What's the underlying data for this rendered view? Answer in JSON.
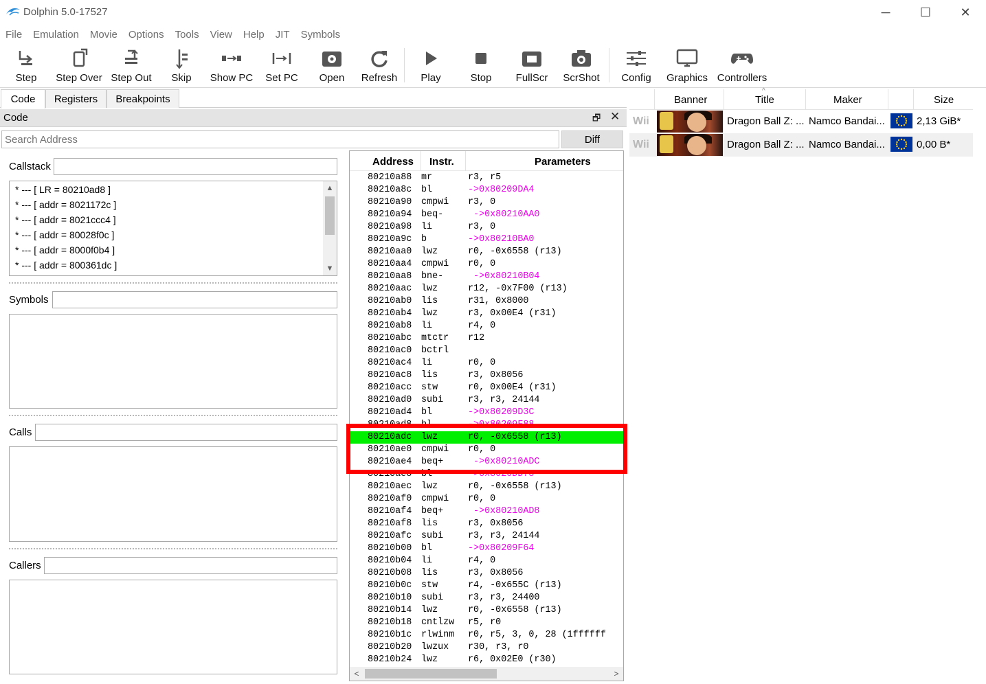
{
  "window": {
    "title": "Dolphin 5.0-17527",
    "minimize": "─",
    "maximize": "☐",
    "close": "✕"
  },
  "menu": [
    "File",
    "Emulation",
    "Movie",
    "Options",
    "Tools",
    "View",
    "Help",
    "JIT",
    "Symbols"
  ],
  "toolbar": {
    "step": "Step",
    "step_over": "Step Over",
    "step_out": "Step Out",
    "skip": "Skip",
    "show_pc": "Show PC",
    "set_pc": "Set PC",
    "open": "Open",
    "refresh": "Refresh",
    "play": "Play",
    "stop": "Stop",
    "fullscr": "FullScr",
    "scrshot": "ScrShot",
    "config": "Config",
    "graphics": "Graphics",
    "controllers": "Controllers"
  },
  "tabs": [
    "Code",
    "Registers",
    "Breakpoints"
  ],
  "code_panel": {
    "title": "Code",
    "float_icon": "🗗",
    "close_icon": "✕",
    "search_placeholder": "Search Address",
    "diff_label": "Diff",
    "callstack_label": "Callstack",
    "symbols_label": "Symbols",
    "calls_label": "Calls",
    "callers_label": "Callers",
    "callstack": [
      "*  ---  [ LR = 80210ad8 ]",
      "*  ---  [ addr = 8021172c ]",
      "*  ---  [ addr = 8021ccc4 ]",
      "*  ---  [ addr = 80028f0c ]",
      "*  ---  [ addr = 8000f0b4 ]",
      "*  ---  [ addr = 800361dc ]"
    ]
  },
  "code_view": {
    "columns": [
      "Address",
      "Instr.",
      "Parameters"
    ],
    "rows": [
      {
        "addr": "80210a88",
        "ins": "mr",
        "par": "r3, r5",
        "branch": false
      },
      {
        "addr": "80210a8c",
        "ins": "bl",
        "par": "->0x80209DA4",
        "branch": true
      },
      {
        "addr": "80210a90",
        "ins": "cmpwi",
        "par": "r3, 0",
        "branch": false
      },
      {
        "addr": "80210a94",
        "ins": "beq-",
        "par": " ->0x80210AA0",
        "branch": true
      },
      {
        "addr": "80210a98",
        "ins": "li",
        "par": "r3, 0",
        "branch": false
      },
      {
        "addr": "80210a9c",
        "ins": "b",
        "par": "->0x80210BA0",
        "branch": true
      },
      {
        "addr": "80210aa0",
        "ins": "lwz",
        "par": "r0, -0x6558 (r13)",
        "branch": false
      },
      {
        "addr": "80210aa4",
        "ins": "cmpwi",
        "par": "r0, 0",
        "branch": false
      },
      {
        "addr": "80210aa8",
        "ins": "bne-",
        "par": " ->0x80210B04",
        "branch": true
      },
      {
        "addr": "80210aac",
        "ins": "lwz",
        "par": "r12, -0x7F00 (r13)",
        "branch": false
      },
      {
        "addr": "80210ab0",
        "ins": "lis",
        "par": "r31, 0x8000",
        "branch": false
      },
      {
        "addr": "80210ab4",
        "ins": "lwz",
        "par": "r3, 0x00E4 (r31)",
        "branch": false
      },
      {
        "addr": "80210ab8",
        "ins": "li",
        "par": "r4, 0",
        "branch": false
      },
      {
        "addr": "80210abc",
        "ins": "mtctr",
        "par": "r12",
        "branch": false
      },
      {
        "addr": "80210ac0",
        "ins": "bctrl",
        "par": "",
        "branch": false
      },
      {
        "addr": "80210ac4",
        "ins": "li",
        "par": "r0, 0",
        "branch": false
      },
      {
        "addr": "80210ac8",
        "ins": "lis",
        "par": "r3, 0x8056",
        "branch": false
      },
      {
        "addr": "80210acc",
        "ins": "stw",
        "par": "r0, 0x00E4 (r31)",
        "branch": false
      },
      {
        "addr": "80210ad0",
        "ins": "subi",
        "par": "r3, r3, 24144",
        "branch": false
      },
      {
        "addr": "80210ad4",
        "ins": "bl",
        "par": "->0x80209D3C",
        "branch": true
      },
      {
        "addr": "80210ad8",
        "ins": "bl",
        "par": "->0x80209F88",
        "branch": true
      },
      {
        "addr": "80210adc",
        "ins": "lwz",
        "par": "r0, -0x6558 (r13)",
        "branch": false,
        "pc": true
      },
      {
        "addr": "80210ae0",
        "ins": "cmpwi",
        "par": "r0, 0",
        "branch": false
      },
      {
        "addr": "80210ae4",
        "ins": "beq+",
        "par": " ->0x80210ADC",
        "branch": true
      },
      {
        "addr": "80210ae8",
        "ins": "bl",
        "par": "->0x8020DD78",
        "branch": true
      },
      {
        "addr": "80210aec",
        "ins": "lwz",
        "par": "r0, -0x6558 (r13)",
        "branch": false
      },
      {
        "addr": "80210af0",
        "ins": "cmpwi",
        "par": "r0, 0",
        "branch": false
      },
      {
        "addr": "80210af4",
        "ins": "beq+",
        "par": " ->0x80210AD8",
        "branch": true
      },
      {
        "addr": "80210af8",
        "ins": "lis",
        "par": "r3, 0x8056",
        "branch": false
      },
      {
        "addr": "80210afc",
        "ins": "subi",
        "par": "r3, r3, 24144",
        "branch": false
      },
      {
        "addr": "80210b00",
        "ins": "bl",
        "par": "->0x80209F64",
        "branch": true
      },
      {
        "addr": "80210b04",
        "ins": "li",
        "par": "r4, 0",
        "branch": false
      },
      {
        "addr": "80210b08",
        "ins": "lis",
        "par": "r3, 0x8056",
        "branch": false
      },
      {
        "addr": "80210b0c",
        "ins": "stw",
        "par": "r4, -0x655C (r13)",
        "branch": false
      },
      {
        "addr": "80210b10",
        "ins": "subi",
        "par": "r3, r3, 24400",
        "branch": false
      },
      {
        "addr": "80210b14",
        "ins": "lwz",
        "par": "r0, -0x6558 (r13)",
        "branch": false
      },
      {
        "addr": "80210b18",
        "ins": "cntlzw",
        "par": "r5, r0",
        "branch": false
      },
      {
        "addr": "80210b1c",
        "ins": "rlwinm",
        "par": "r0, r5, 3, 0, 28 (1ffffff",
        "branch": false
      },
      {
        "addr": "80210b20",
        "ins": "lwzux",
        "par": "r30, r3, r0",
        "branch": false
      },
      {
        "addr": "80210b24",
        "ins": "lwz",
        "par": "r6, 0x02E0 (r30)",
        "branch": false
      }
    ],
    "h_scroll_left": "<",
    "h_scroll_right": ">"
  },
  "game_list": {
    "columns": [
      "Banner",
      "Title",
      "Maker",
      "Size"
    ],
    "rows": [
      {
        "platform": "Wii",
        "title": "Dragon Ball Z: ...",
        "maker": "Namco Bandai...",
        "size": "2,13 GiB*"
      },
      {
        "platform": "Wii",
        "title": "Dragon Ball Z: ...",
        "maker": "Namco Bandai...",
        "size": "0,00 B*"
      }
    ]
  },
  "colors": {
    "pc_highlight": "#00ee00",
    "branch_text": "#ee00ee",
    "annotation_box": "#ff0000"
  }
}
